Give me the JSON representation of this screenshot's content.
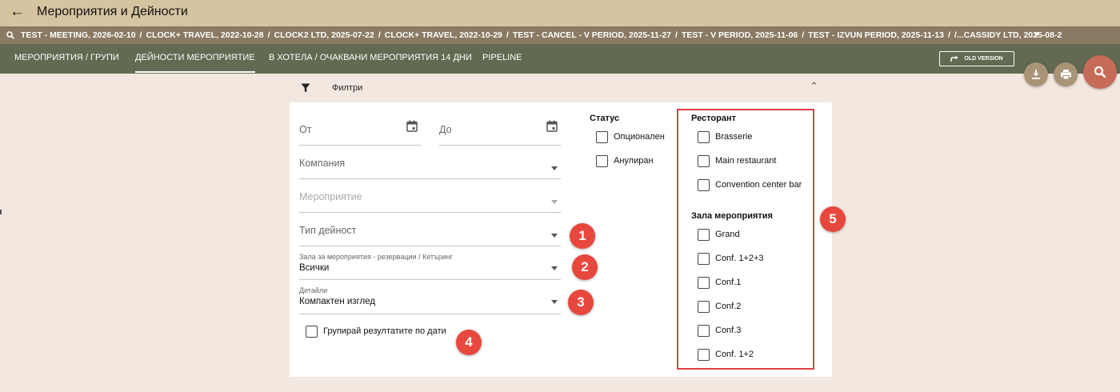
{
  "header": {
    "back_icon": "arrow-left-icon",
    "title": "Мероприятия и Дейности"
  },
  "recent": {
    "search_icon": "search-icon",
    "items": [
      "TEST - MEETING, 2026-02-10",
      "CLOCK+ TRAVEL, 2022-10-28",
      "CLOCK2 LTD, 2025-07-22",
      "CLOCK+ TRAVEL, 2022-10-29",
      "TEST - CANCEL - V PERIOD, 2025-11-27",
      "TEST - V PERIOD, 2025-11-06",
      "TEST - IZVUN PERIOD, 2025-11-13",
      "/...CASSIDY LTD, 2025-08-2"
    ],
    "separator": "/",
    "expand_icon": "chevron-down-icon"
  },
  "nav": {
    "tabs": [
      {
        "label": "МЕРОПРИЯТИЯ / ГРУПИ"
      },
      {
        "label": "ДЕЙНОСТИ МЕРОПРИЯТИЕ",
        "active": true
      },
      {
        "label": "В ХОТЕЛА / ОЧАКВАНИ МЕРОПРИЯТИЯ 14 ДНИ"
      },
      {
        "label": "PIPELINE"
      }
    ],
    "old_version": "OLD VERSION"
  },
  "actions": {
    "download_icon": "download-icon",
    "print_icon": "print-icon",
    "search_icon": "search-icon"
  },
  "filters": {
    "title": "Филтри",
    "filter_icon": "filter-icon",
    "collapse_icon": "chevron-up-icon",
    "from_label": "От",
    "to_label": "До",
    "company_label": "Компания",
    "event_label": "Мероприятие",
    "activity_type_label": "Тип дейност",
    "hall_label": "Зала за мероприятия - резервации / Кетъринг",
    "hall_value": "Всички",
    "details_label": "Детайли",
    "details_value": "Компактен изглед",
    "group_by_date": "Групирай резултатите по дати",
    "status": {
      "title": "Статус",
      "options": [
        "Опционален",
        "Анулиран"
      ]
    },
    "restaurant": {
      "title": "Ресторант",
      "options": [
        "Brasserie",
        "Main restaurant",
        "Convention center bar"
      ]
    },
    "event_hall": {
      "title": "Зала мероприятия",
      "options": [
        "Grand",
        "Conf. 1+2+3",
        "Conf.1",
        "Conf.2",
        "Conf.3",
        "Conf. 1+2"
      ]
    }
  },
  "annotations": {
    "badges": [
      "1",
      "2",
      "3",
      "4",
      "5"
    ],
    "highlight_color": "#e04048",
    "badge_color": "#e8473e"
  }
}
